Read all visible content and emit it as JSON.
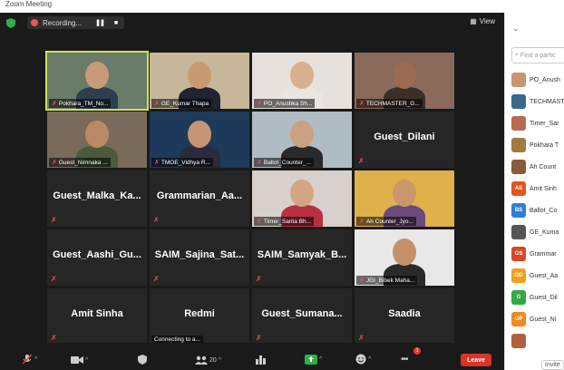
{
  "window": {
    "title": "Zoom Meeting"
  },
  "topbar": {
    "recording_label": "Recording...",
    "pause": "❚❚",
    "stop": "■",
    "view_label": "View"
  },
  "tiles": [
    {
      "name": "Pokhara_TM_No...",
      "type": "video",
      "bg": "#6b7b6a",
      "skin": "#c59b78",
      "shirt": "#2c3e50"
    },
    {
      "name": "GE_Kumar Thapa",
      "type": "video",
      "bg": "#c6b79a",
      "skin": "#c79a72",
      "shirt": "#1e2430"
    },
    {
      "name": "PO_Anushka Sh...",
      "type": "video",
      "bg": "#e6e1dc",
      "skin": "#d8b08c",
      "shirt": "#e9e6e2"
    },
    {
      "name": "TECHMASTER_G...",
      "type": "video",
      "bg": "#8a6a5a",
      "skin": "#9b6b4f",
      "shirt": "#3b2f2a"
    },
    {
      "name": "Guest_Nimnaka ...",
      "type": "video",
      "bg": "#7a6a5a",
      "skin": "#b98a66",
      "shirt": "#4a5a3a"
    },
    {
      "name": "TMOE_Vidhya R...",
      "type": "video",
      "bg": "#1d3a5a",
      "skin": "#c79575",
      "shirt": "#2b2b3b"
    },
    {
      "name": "Ballot_Counter_...",
      "type": "video",
      "bg": "#b0bcc4",
      "skin": "#caa182",
      "shirt": "#2a2a2a"
    },
    {
      "name": "Guest_Dilani",
      "type": "name"
    },
    {
      "name": "Guest_Malka_Ka...",
      "type": "name"
    },
    {
      "name": "Grammarian_Aa...",
      "type": "name"
    },
    {
      "name": "Timer_Sarita Bh...",
      "type": "photo",
      "bg": "#d8d0cc",
      "skin": "#d4a583",
      "shirt": "#b83040"
    },
    {
      "name": "Ah Counter_Jyo...",
      "type": "photo",
      "bg": "#e0b04a",
      "skin": "#c9966e",
      "shirt": "#6a4a7a"
    },
    {
      "name": "Guest_Aashi_Gu...",
      "type": "name"
    },
    {
      "name": "SAIM_Sajina_Sat...",
      "type": "name"
    },
    {
      "name": "SAIM_Samyak_B...",
      "type": "name"
    },
    {
      "name": "JGI_Bibek Maha...",
      "type": "photo",
      "bg": "#e8e8e8",
      "skin": "#c69169",
      "shirt": "#2a2a2a"
    },
    {
      "name": "Amit Sinha",
      "type": "name"
    },
    {
      "name": "Redmi",
      "type": "name",
      "sub": "Connecting to a..."
    },
    {
      "name": "Guest_Sumana...",
      "type": "name"
    },
    {
      "name": "Saadia",
      "type": "name"
    }
  ],
  "bottombar": {
    "participants_count": "20",
    "chat_badge": "1",
    "leave_label": "Leave"
  },
  "panel": {
    "search_placeholder": "Find a partic",
    "participants": [
      {
        "name": "PO_Anush",
        "initials": "",
        "color": "#c9956e"
      },
      {
        "name": "TECHMAST",
        "initials": "",
        "color": "#3a6a8a"
      },
      {
        "name": "Timer_Sar",
        "initials": "",
        "color": "#b86a50"
      },
      {
        "name": "Pokhara T",
        "initials": "",
        "color": "#a07a40"
      },
      {
        "name": "Ah Count",
        "initials": "",
        "color": "#8a5a3a"
      },
      {
        "name": "Amit Sinh",
        "initials": "AS",
        "color": "#e0561f"
      },
      {
        "name": "Ballot_Co",
        "initials": "BS",
        "color": "#2f7fd6"
      },
      {
        "name": "GE_Kuma",
        "initials": "",
        "color": "#555"
      },
      {
        "name": "Grammar",
        "initials": "GS",
        "color": "#d9472a"
      },
      {
        "name": "Guest_Aa",
        "initials": "GG",
        "color": "#f0a020"
      },
      {
        "name": "Guest_Dil",
        "initials": "G",
        "color": "#33a845"
      },
      {
        "name": "Guest_Ni",
        "initials": "GP",
        "color": "#f08a20"
      },
      {
        "name": "",
        "initials": "",
        "color": "#b06040"
      }
    ],
    "invite_label": "Invite"
  }
}
